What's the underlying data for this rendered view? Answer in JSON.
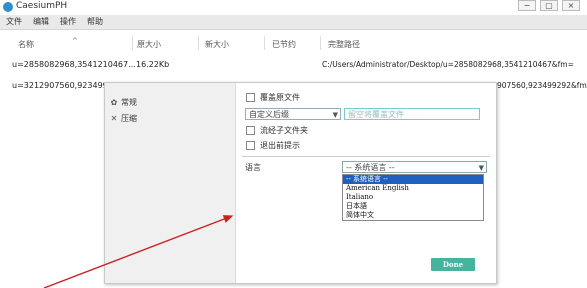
{
  "app": {
    "title": "CaesiumPH",
    "controls": [
      "−",
      "▢",
      "×"
    ]
  },
  "menu": [
    "文件",
    "编辑",
    "操作",
    "帮助"
  ],
  "columns": [
    "名称",
    "原大小",
    "新大小",
    "已节约",
    "完整路径"
  ],
  "sort_indicator": "^",
  "rows": [
    {
      "name": "u=2858082968,3541210467...",
      "size": "16.22Kb",
      "path": "C:/Users/Administrator/Desktop/u=2858082968,3541210467&fm="
    },
    {
      "name": "u=3212907560,923499292...",
      "size": "",
      "path": "907560,923499292&fm="
    }
  ],
  "dialog": {
    "sidebar": [
      {
        "label": "常规",
        "icon": "gear-icon"
      },
      {
        "label": "压缩",
        "icon": "compress-icon"
      }
    ],
    "overwrite_label": "覆盖原文件",
    "suffix_select": "自定义后缀",
    "output_placeholder": "留空将覆盖文件",
    "subfolders_label": "流经子文件夹",
    "exit_prompt_label": "退出前提示",
    "language_label": "语言",
    "language_selected": "-- 系统语言 --",
    "language_options": [
      "-- 系统语言 --",
      "American English",
      "Italiano",
      "日本語",
      "简体中文"
    ],
    "done_label": "Done"
  },
  "colors": {
    "accent": "#45b39d",
    "selection": "#1f5fbf",
    "arrow": "#cc2222"
  }
}
